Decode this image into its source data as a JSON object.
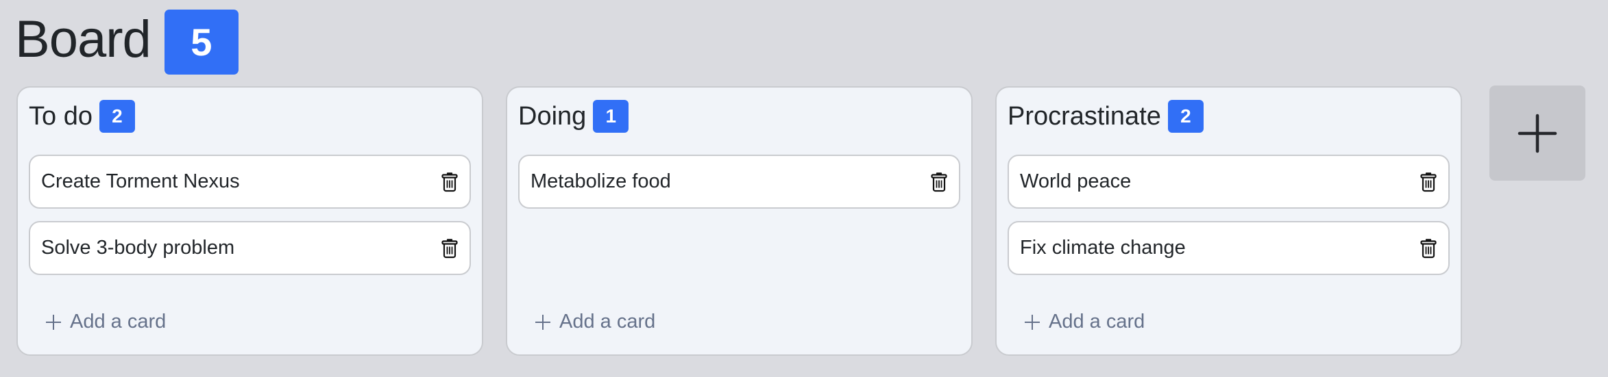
{
  "header": {
    "title": "Board",
    "total_count": "5"
  },
  "columns": [
    {
      "title": "To do",
      "count": "2",
      "cards": [
        {
          "text": "Create Torment Nexus",
          "icon": "trash-icon"
        },
        {
          "text": "Solve 3-body problem",
          "icon": "trash-icon"
        }
      ],
      "add_label": "Add a card"
    },
    {
      "title": "Doing",
      "count": "1",
      "cards": [
        {
          "text": "Metabolize food",
          "icon": "trash-icon"
        }
      ],
      "add_label": "Add a card"
    },
    {
      "title": "Procrastinate",
      "count": "2",
      "cards": [
        {
          "text": "World peace",
          "icon": "trash-icon"
        },
        {
          "text": "Fix climate change",
          "icon": "trash-icon"
        }
      ],
      "add_label": "Add a card"
    }
  ],
  "add_column": {
    "icon": "plus-icon"
  },
  "colors": {
    "background": "#dadbe0",
    "column_bg": "#f1f4f9",
    "accent_badge": "#316ff6",
    "add_card_text": "#65718a",
    "add_column_bg": "#c6c7cc"
  }
}
